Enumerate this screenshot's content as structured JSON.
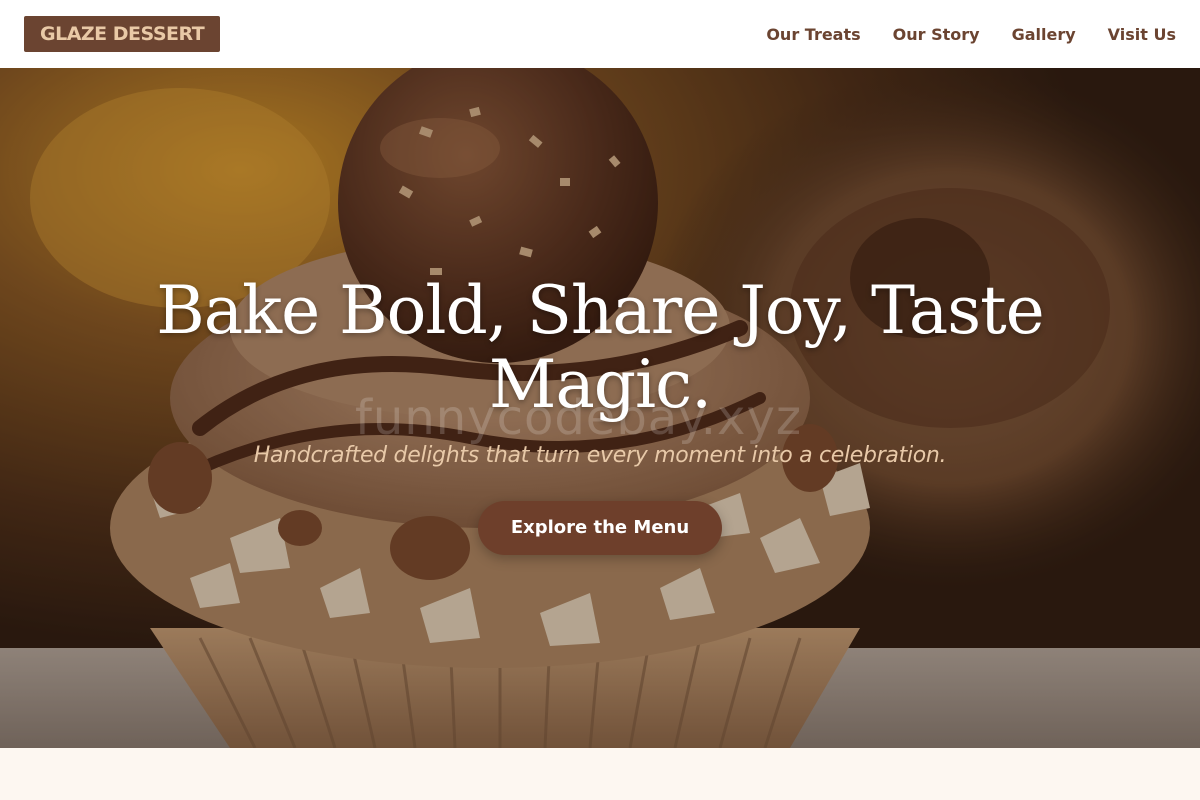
{
  "header": {
    "logo_text": "GLAZE DESSERT",
    "nav": [
      {
        "label": "Our Treats"
      },
      {
        "label": "Our Story"
      },
      {
        "label": "Gallery"
      },
      {
        "label": "Visit Us"
      }
    ]
  },
  "hero": {
    "title": "Bake Bold, Share Joy, Taste Magic.",
    "subtitle": "Handcrafted delights that turn every moment into a celebration.",
    "cta_label": "Explore the Menu",
    "watermark": "funnycodebay.xyz",
    "image_subject": "chocolate hazelnut cupcake"
  },
  "colors": {
    "brand": "#6b4431",
    "cta": "#6e3f2b",
    "subtitle": "#e8c9a8",
    "page_bg": "#fdf7f1"
  }
}
